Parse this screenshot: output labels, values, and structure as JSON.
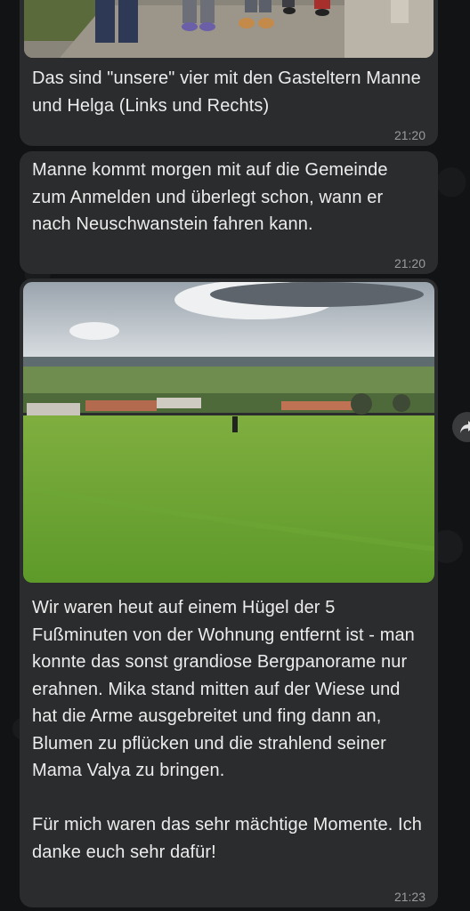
{
  "messages": [
    {
      "text": "Das sind \"unsere\" vier mit den Gasteltern Manne und Helga (Links und Rechts)",
      "time": "21:20",
      "has_photo": true
    },
    {
      "text": "Manne kommt morgen mit auf die Gemeinde zum Anmelden und überlegt schon, wann er nach Neuschwanstein fahren kann.",
      "time": "21:20",
      "has_photo": false
    },
    {
      "text": "Wir waren heut auf einem Hügel der 5 Fußminuten von der Wohnung entfernt ist - man konnte das sonst grandiose Bergpanorame nur erahnen. Mika stand mitten auf der Wiese und hat die Arme ausgebreitet und fing dann an, Blumen zu pflücken und die strahlend seiner Mama Valya zu bringen.\n\nFür mich waren das sehr mächtige Momente. Ich danke euch sehr dafür!",
      "time": "21:23",
      "has_photo": true
    }
  ],
  "icons": {
    "forward": "forward-arrow-icon"
  },
  "colors": {
    "background": "#121315",
    "bubble": "#2b2c2e",
    "text": "#ececec",
    "timestamp": "#9a9b9d"
  }
}
